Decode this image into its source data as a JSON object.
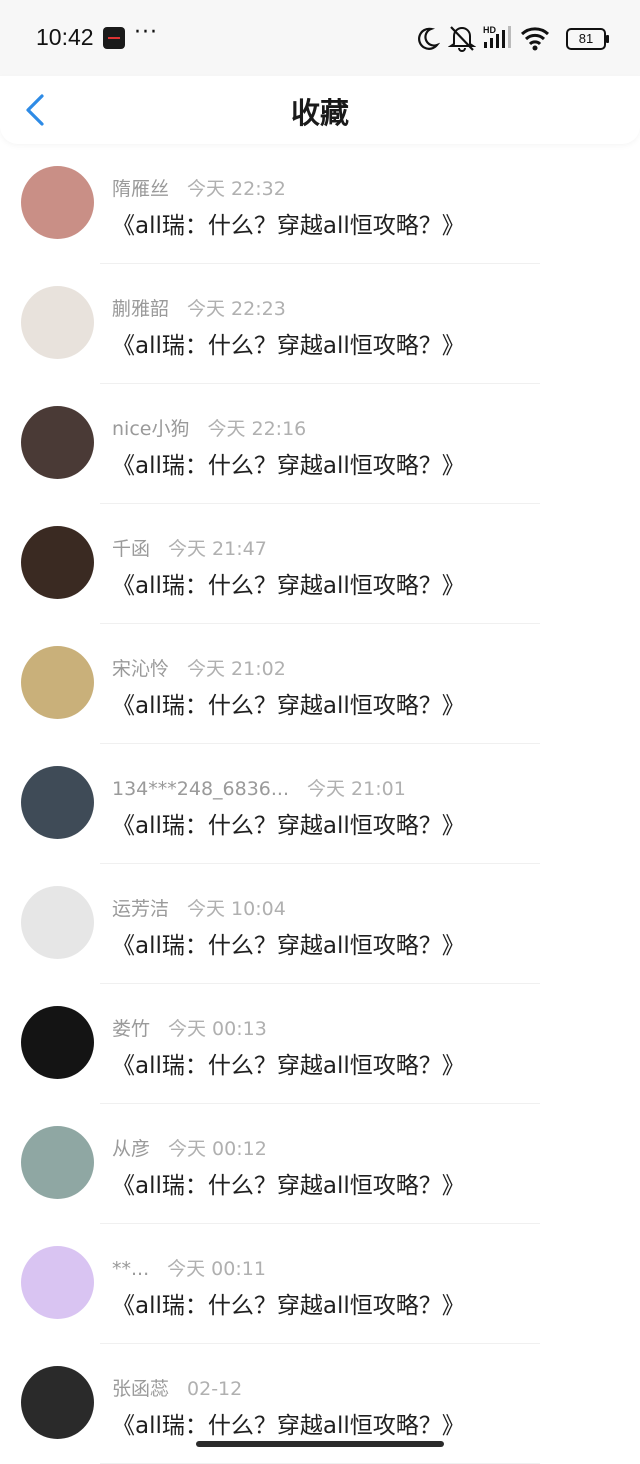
{
  "status_bar": {
    "time": "10:42",
    "more": "···",
    "battery": "81",
    "icons": [
      "app-notification-icon",
      "moon-icon",
      "mute-icon",
      "signal-hd-icon",
      "wifi-icon",
      "battery-icon"
    ]
  },
  "header": {
    "back_icon": "chevron-left-icon",
    "title": "收藏"
  },
  "accent_color": "#2e8be6",
  "items": [
    {
      "name": "隋雁丝",
      "time": "今天 22:32",
      "content": "《all瑞：什么？穿越all恒攻略？》",
      "avatar_color": "#c98f86"
    },
    {
      "name": "蒯雅韶",
      "time": "今天 22:23",
      "content": "《all瑞：什么？穿越all恒攻略？》",
      "avatar_color": "#e8e2dc"
    },
    {
      "name": "nice小狗",
      "time": "今天 22:16",
      "content": "《all瑞：什么？穿越all恒攻略？》",
      "avatar_color": "#4a3a36"
    },
    {
      "name": "千函",
      "time": "今天 21:47",
      "content": "《all瑞：什么？穿越all恒攻略？》",
      "avatar_color": "#3a2a22"
    },
    {
      "name": "宋沁怜",
      "time": "今天 21:02",
      "content": "《all瑞：什么？穿越all恒攻略？》",
      "avatar_color": "#c9b07a"
    },
    {
      "name": "134***248_6836...",
      "time": "今天 21:01",
      "content": "《all瑞：什么？穿越all恒攻略？》",
      "avatar_color": "#3f4b57"
    },
    {
      "name": "运芳洁",
      "time": "今天 10:04",
      "content": "《all瑞：什么？穿越all恒攻略？》",
      "avatar_color": "#e6e6e6"
    },
    {
      "name": "娄竹",
      "time": "今天 00:13",
      "content": "《all瑞：什么？穿越all恒攻略？》",
      "avatar_color": "#141414"
    },
    {
      "name": "从彦",
      "time": "今天 00:12",
      "content": "《all瑞：什么？穿越all恒攻略？》",
      "avatar_color": "#8fa7a3"
    },
    {
      "name": "**...",
      "time": "今天 00:11",
      "content": "《all瑞：什么？穿越all恒攻略？》",
      "avatar_color": "#d9c4f2"
    },
    {
      "name": "张函蕊",
      "time": "02-12",
      "content": "《all瑞：什么？穿越all恒攻略？》",
      "avatar_color": "#2a2a2a"
    }
  ]
}
